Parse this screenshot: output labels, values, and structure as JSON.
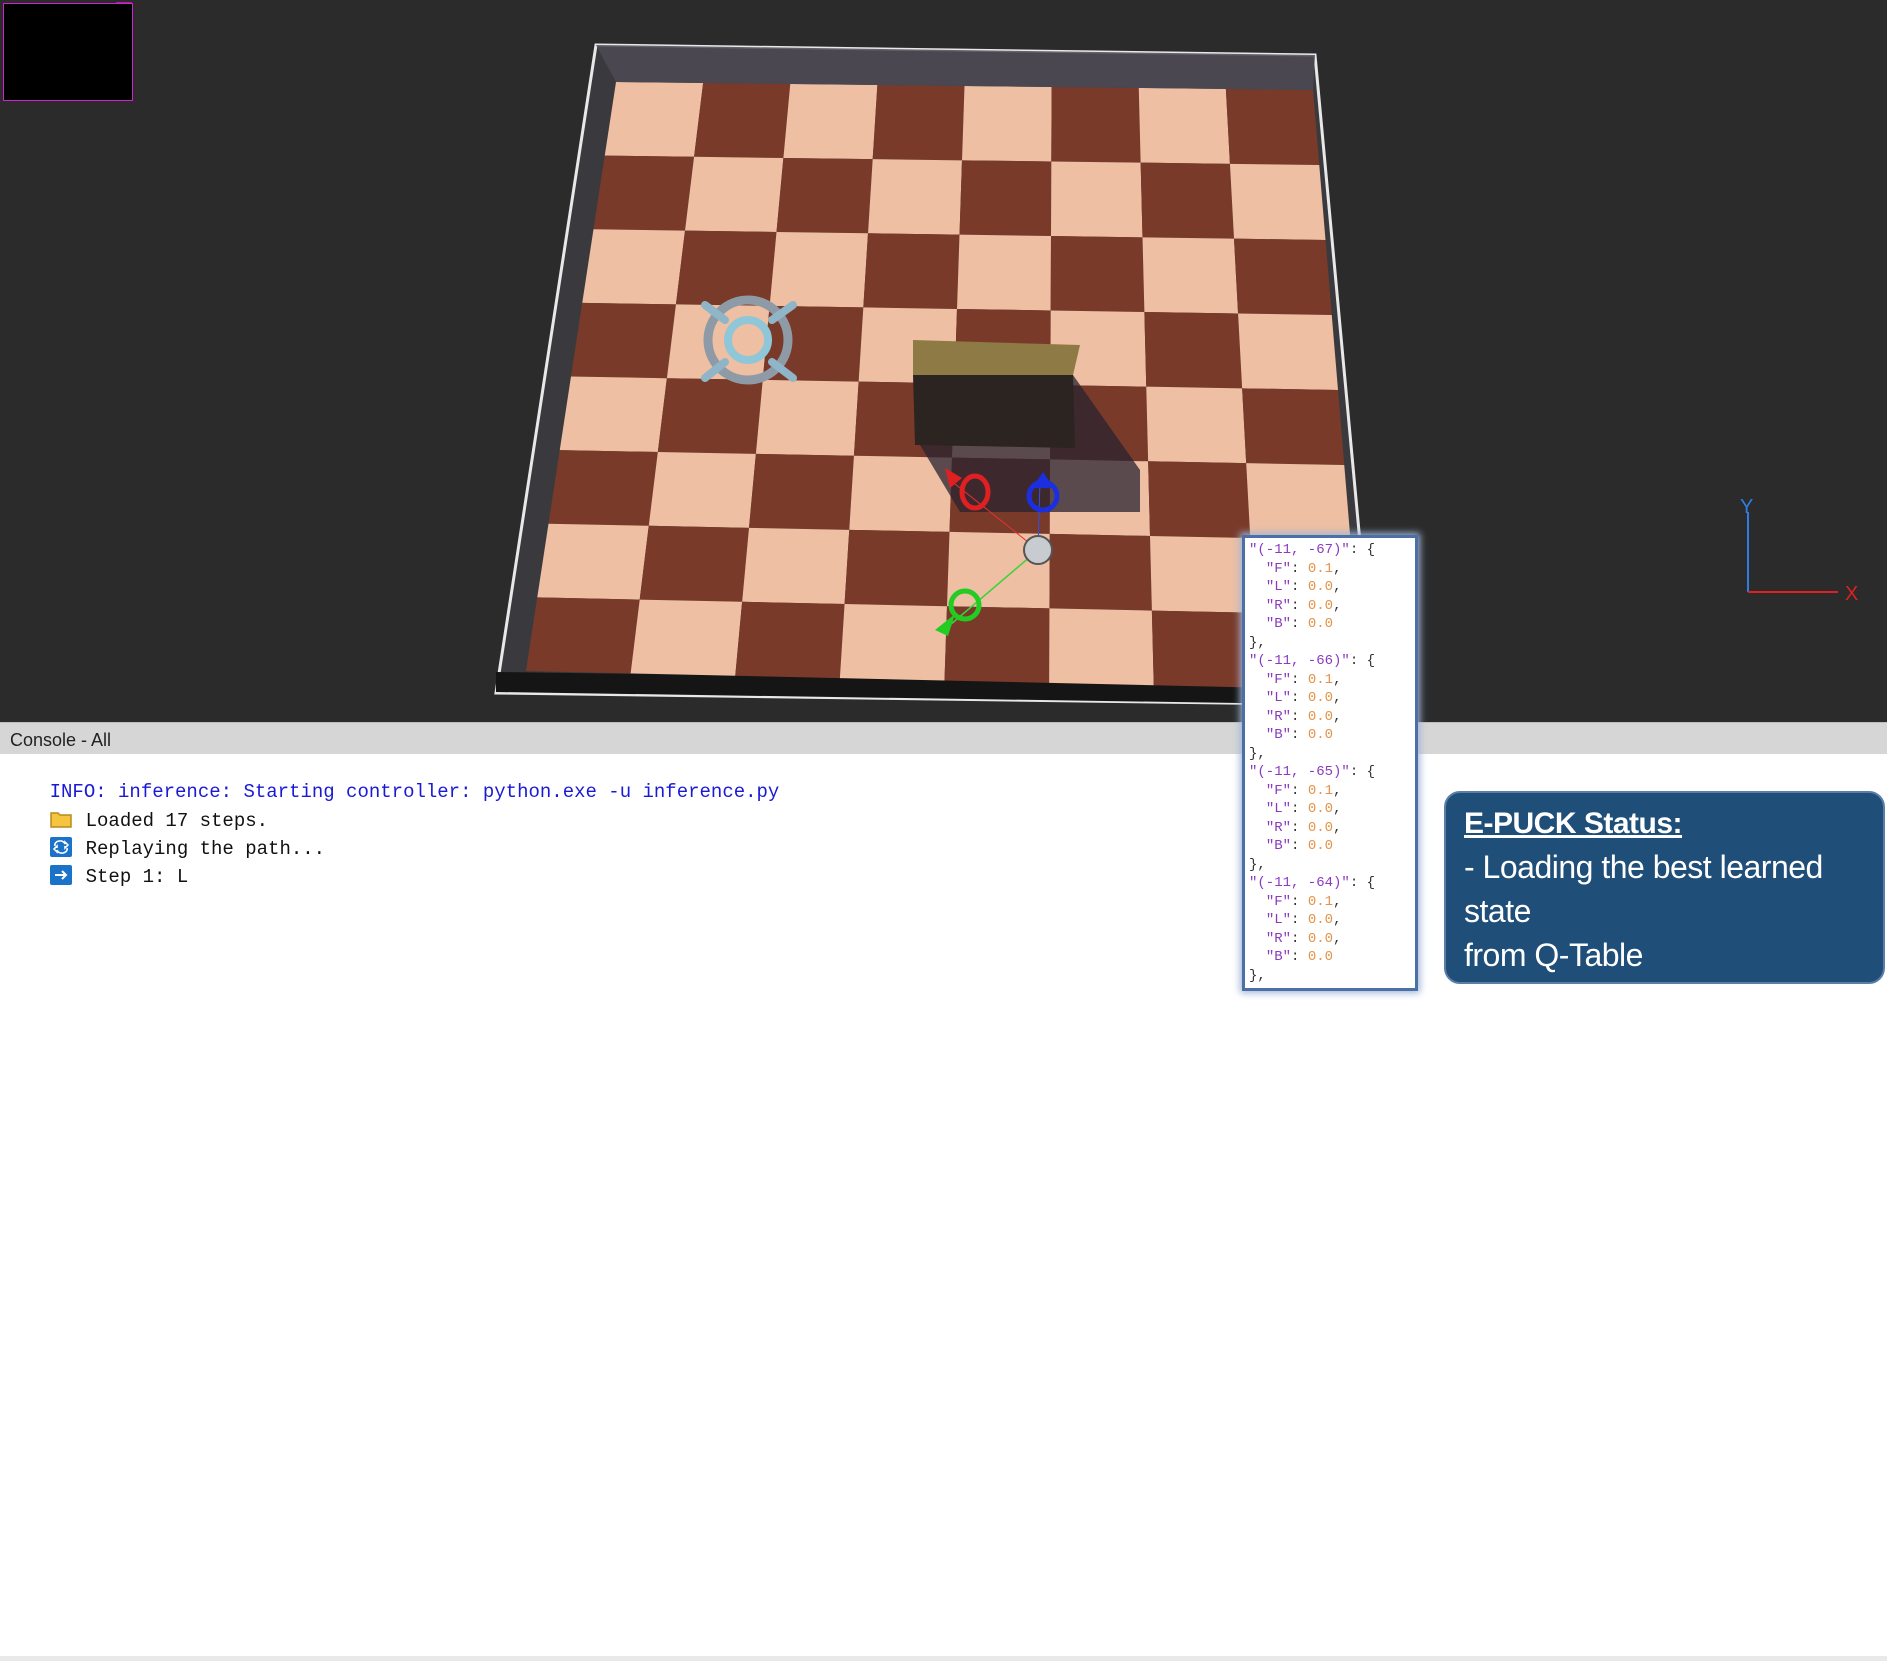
{
  "viewport": {
    "axis": {
      "y_label": "Y",
      "x_label": "X"
    },
    "colors": {
      "axis_y": "#2f7de0",
      "axis_x": "#e02020",
      "overlay_border": "#d21fd2"
    }
  },
  "console": {
    "title": "Console - All",
    "lines": [
      {
        "type": "info",
        "icon": "",
        "text": "INFO: inference: Starting controller: python.exe -u inference.py"
      },
      {
        "type": "msg",
        "icon": "folder-icon",
        "text": "Loaded 17 steps."
      },
      {
        "type": "msg",
        "icon": "repeat-icon",
        "text": "Replaying the path..."
      },
      {
        "type": "msg",
        "icon": "arrow-right-icon",
        "text": "Step 1: L"
      }
    ]
  },
  "qtable": {
    "entries": [
      {
        "key": "\"(-11, -67)\"",
        "F": "0.1",
        "L": "0.0",
        "R": "0.0",
        "B": "0.0"
      },
      {
        "key": "\"(-11, -66)\"",
        "F": "0.1",
        "L": "0.0",
        "R": "0.0",
        "B": "0.0"
      },
      {
        "key": "\"(-11, -65)\"",
        "F": "0.1",
        "L": "0.0",
        "R": "0.0",
        "B": "0.0"
      },
      {
        "key": "\"(-11, -64)\"",
        "F": "0.1",
        "L": "0.0",
        "R": "0.0",
        "B": "0.0"
      }
    ]
  },
  "status": {
    "title": "E-PUCK Status:",
    "line1": "- Loading the best learned state",
    "line2": "from Q-Table"
  }
}
